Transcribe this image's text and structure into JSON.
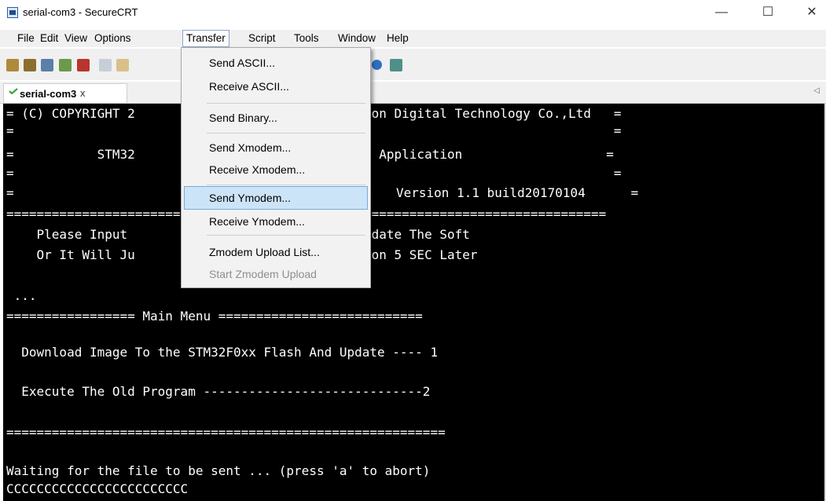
{
  "window": {
    "title": "serial-com3 - SecureCRT",
    "minimize_glyph": "—",
    "maximize_glyph": "☐",
    "close_glyph": "✕"
  },
  "menubar": {
    "items": [
      "File",
      "Edit",
      "View",
      "Options",
      "Transfer",
      "Script",
      "Tools",
      "Window",
      "Help"
    ]
  },
  "tab": {
    "label": "serial-com3",
    "close_glyph": "x",
    "scroll_glyph": "◁"
  },
  "transfer_menu": {
    "items": [
      {
        "label": "Send ASCII..."
      },
      {
        "label": "Receive ASCII..."
      },
      {
        "label": "Send Binary..."
      },
      {
        "label": "Send Xmodem..."
      },
      {
        "label": "Receive Xmodem..."
      },
      {
        "label": "Send Ymodem...",
        "state": "selected"
      },
      {
        "label": "Receive Ymodem..."
      },
      {
        "label": "Zmodem Upload List..."
      },
      {
        "label": "Start Zmodem Upload",
        "state": "disabled"
      }
    ]
  },
  "terminal": {
    "lines": [
      "= (C) COPYRIGHT 2",
      "=",
      "=           STM32",
      "=",
      "=",
      "=========================",
      "    Please Input",
      "    Or It Will Ju",
      "",
      " ...",
      "================= Main Menu ===========================",
      "",
      "  Download Image To the STM32F0xx Flash And Update ---- 1",
      "",
      "  Execute The Old Program -----------------------------2",
      "",
      "==========================================================",
      "",
      "Waiting for the file to be sent ... (press 'a' to abort)",
      "CCCCCCCCCCCCCCCCCCCCCCCC"
    ],
    "right_fragments": [
      "ion Digital Technology Co.,Ltd   =",
      "                                 =",
      "e Application                   =",
      "                                 =",
      "Version 1.1 build20170104      =",
      "================================",
      "pdate The Soft",
      "ion 5 SEC Later"
    ]
  },
  "colors": {
    "terminal_bg": "#000000",
    "terminal_fg": "#ffffff",
    "menu_highlight": "#cce4f7"
  }
}
